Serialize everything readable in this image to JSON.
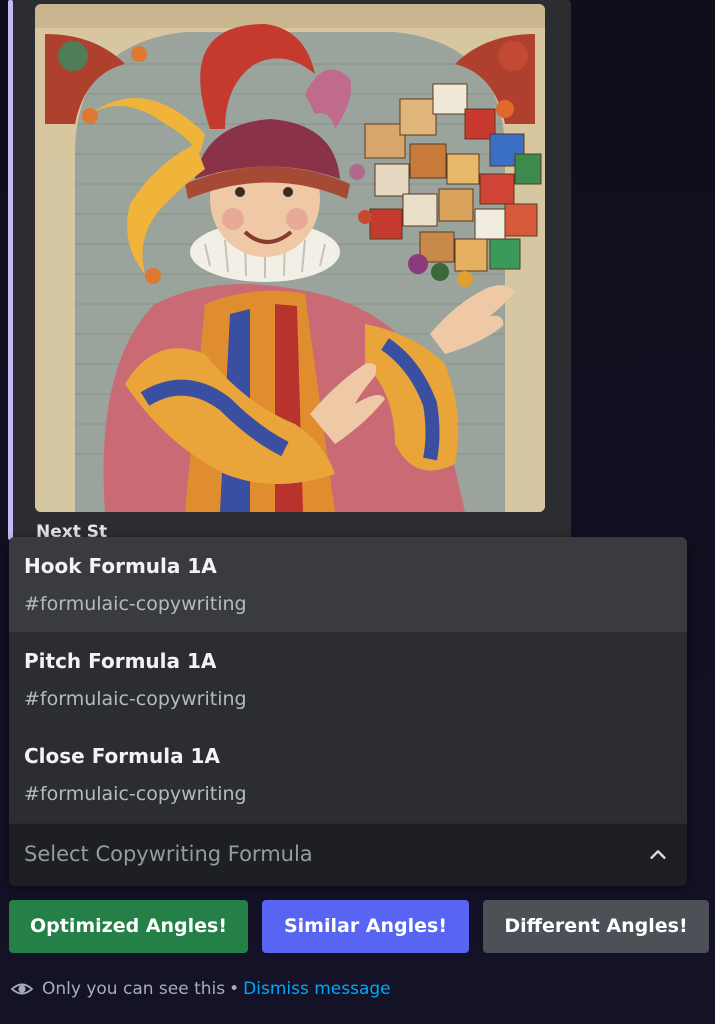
{
  "embed": {
    "image_alt": "Medieval-style painting of a jester juggling cardboard shipping boxes",
    "peek_text": "Next St"
  },
  "menu": {
    "options": [
      {
        "title": "Hook Formula 1A",
        "description": "#formulaic-copywriting"
      },
      {
        "title": "Pitch Formula 1A",
        "description": "#formulaic-copywriting"
      },
      {
        "title": "Close Formula 1A",
        "description": "#formulaic-copywriting"
      }
    ],
    "placeholder": "Select Copywriting Formula"
  },
  "buttons": {
    "optimized": "Optimized Angles!",
    "similar": "Similar Angles!",
    "different": "Different Angles!"
  },
  "ephemeral": {
    "notice": "Only you can see this",
    "separator": "•",
    "dismiss": "Dismiss message"
  },
  "colors": {
    "green": "#248046",
    "blurple": "#5865f2",
    "grey": "#4e5058",
    "link": "#00a8fc"
  },
  "icons": {
    "eye": "eye-icon",
    "chevron": "chevron-up-icon"
  }
}
